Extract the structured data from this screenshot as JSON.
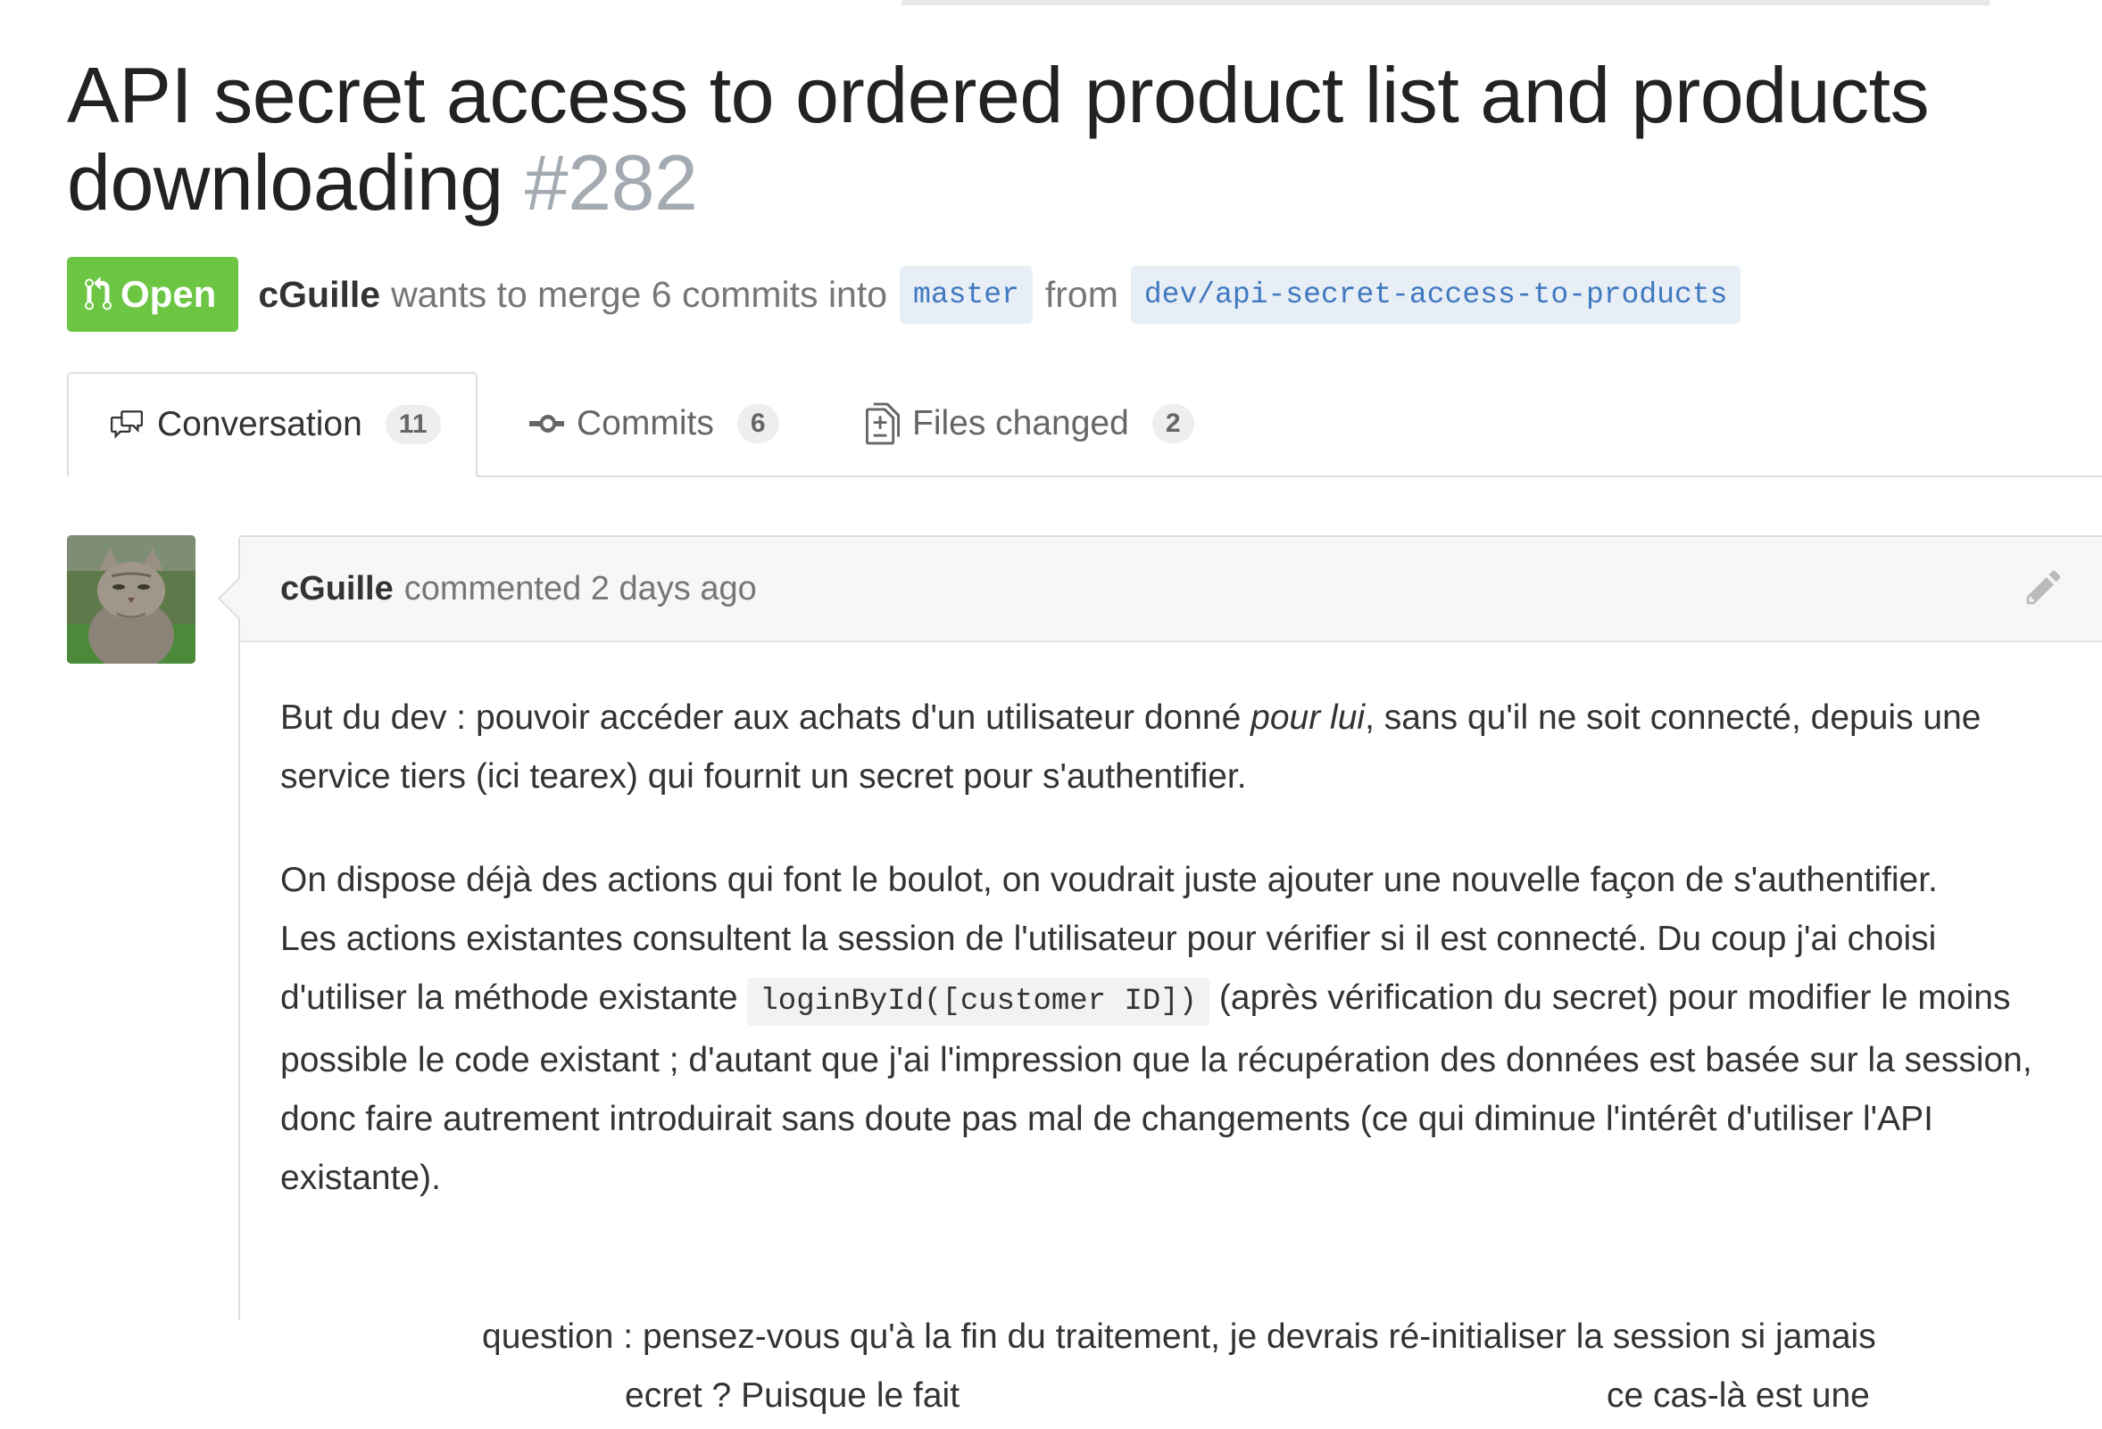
{
  "pull_request": {
    "title": "API secret access to ordered product list and products downloading",
    "number": "#282",
    "state": "Open",
    "author": "cGuille",
    "merge_text": "wants to merge 6 commits into",
    "base_branch": "master",
    "from_text": "from",
    "head_branch": "dev/api-secret-access-to-products"
  },
  "tabs": [
    {
      "label": "Conversation",
      "count": "11",
      "icon": "comment-discussion-icon",
      "selected": true
    },
    {
      "label": "Commits",
      "count": "6",
      "icon": "commit-icon",
      "selected": false
    },
    {
      "label": "Files changed",
      "count": "2",
      "icon": "file-diff-icon",
      "selected": false
    }
  ],
  "comment": {
    "author": "cGuille",
    "action": "commented 2 days ago",
    "edit_icon": "pencil-icon",
    "p1_before": "But du dev : pouvoir accéder aux achats d'un utilisateur donné ",
    "p1_em": "pour lui",
    "p1_after": ", sans qu'il ne soit connecté, depuis une service tiers (ici tearex) qui fournit un secret pour s'authentifier.",
    "p2": "On dispose déjà des actions qui font le boulot, on voudrait juste ajouter une nouvelle façon de s'authentifier.",
    "p3_before": "Les actions existantes consultent la session de l'utilisateur pour vérifier si il est connecté. Du coup j'ai choisi d'utiliser la méthode existante ",
    "p3_code": "loginById([customer ID])",
    "p3_after": " (après vérification du secret) pour modifier le moins possible le code existant ; d'autant que j'ai l'impression que la récupération des données est basée sur la session, donc faire autrement introduirait sans doute pas mal de changements (ce qui diminue l'intérêt d'utiliser l'API existante).",
    "cut_line_1": "question : pensez-vous qu'à la fin du traitement, je devrais ré-initialiser la session si jamais",
    "cut_line_2a": "ecret ? Puisque le fait",
    "cut_line_2b": "ce cas-là est une"
  },
  "colors": {
    "open_green": "#6cc644",
    "branch_blue": "#4078c0",
    "branch_bg": "#e7eef6",
    "muted_gray": "#a3aab1"
  }
}
